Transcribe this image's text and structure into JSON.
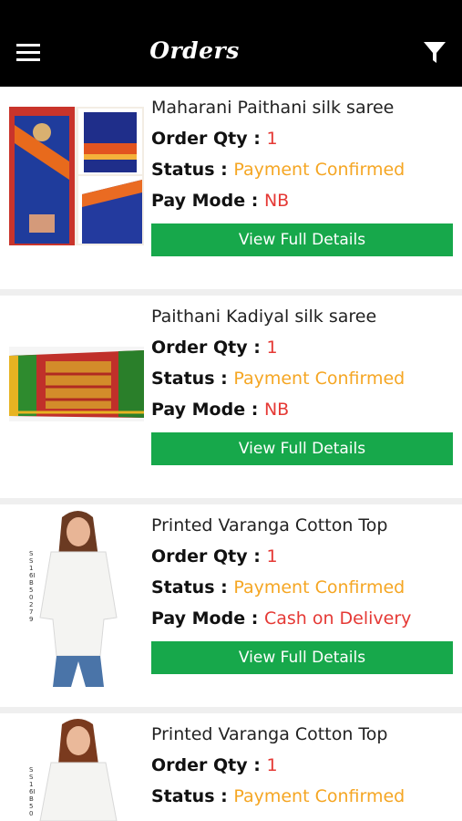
{
  "header": {
    "title": "Orders",
    "menu_icon": "hamburger-menu-icon",
    "filter_icon": "filter-funnel-icon"
  },
  "labels": {
    "order_qty": "Order Qty : ",
    "status": "Status : ",
    "pay_mode": "Pay Mode : ",
    "view_button": "View Full Details"
  },
  "colors": {
    "header_bg": "#000000",
    "button_bg": "#17a84b",
    "qty_value": "#e53935",
    "status_value": "#f5a623",
    "paymode_value": "#e53935"
  },
  "orders": [
    {
      "name": "Maharani Paithani silk saree",
      "qty": "1",
      "status": "Payment Confirmed",
      "pay_mode": "NB"
    },
    {
      "name": "Paithani Kadiyal silk saree",
      "qty": "1",
      "status": "Payment Confirmed",
      "pay_mode": "NB"
    },
    {
      "name": "Printed Varanga Cotton Top",
      "qty": "1",
      "status": "Payment Confirmed",
      "pay_mode": "Cash on Delivery",
      "sku_label": "SS16IB50279"
    },
    {
      "name": "Printed Varanga Cotton Top",
      "qty": "1",
      "status": "Payment Confirmed",
      "sku_label": "SS16IB50"
    }
  ]
}
